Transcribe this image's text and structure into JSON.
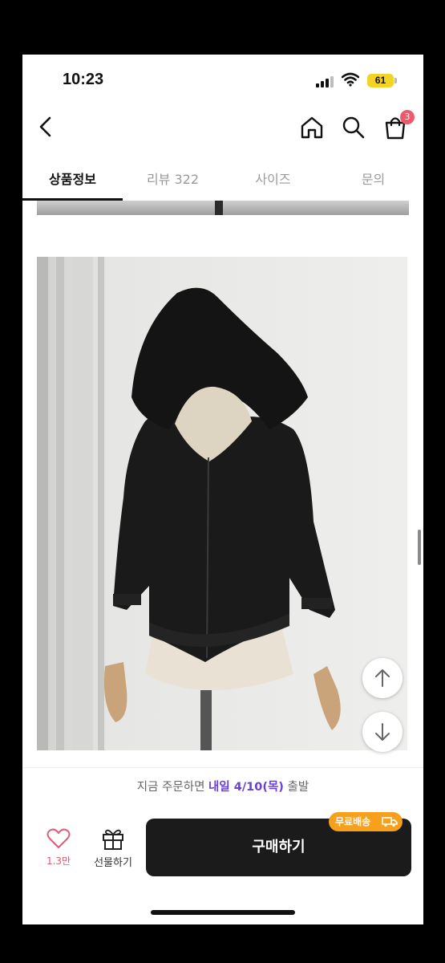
{
  "status_bar": {
    "time": "10:23",
    "battery": "61",
    "battery_color": "#f3d324"
  },
  "header": {
    "back_icon": "chevron-left-icon",
    "home_icon": "home-icon",
    "search_icon": "search-icon",
    "cart_icon": "shopping-bag-icon",
    "cart_count": "3",
    "badge_color": "#ee5a6b"
  },
  "tabs": [
    {
      "label": "상품정보",
      "active": true
    },
    {
      "label": "리뷰 322",
      "active": false
    },
    {
      "label": "사이즈",
      "active": false
    },
    {
      "label": "문의",
      "active": false
    }
  ],
  "product_image": {
    "subject": "black zip-up hoodie on mannequin"
  },
  "floating_buttons": {
    "up_icon": "arrow-up-icon",
    "down_icon": "arrow-down-icon"
  },
  "shipping_notice": {
    "prefix": "지금 주문하면 ",
    "highlight": "내일 4/10(목)",
    "suffix": " 출발",
    "highlight_color": "#6a3fd8"
  },
  "bottom_bar": {
    "like_icon": "heart-icon",
    "like_count": "1.3만",
    "gift_icon": "gift-icon",
    "gift_label": "선물하기",
    "buy_label": "구매하기",
    "free_shipping_label": "무료배송",
    "free_shipping_icon": "truck-icon",
    "accent_color": "#f6a01c"
  }
}
